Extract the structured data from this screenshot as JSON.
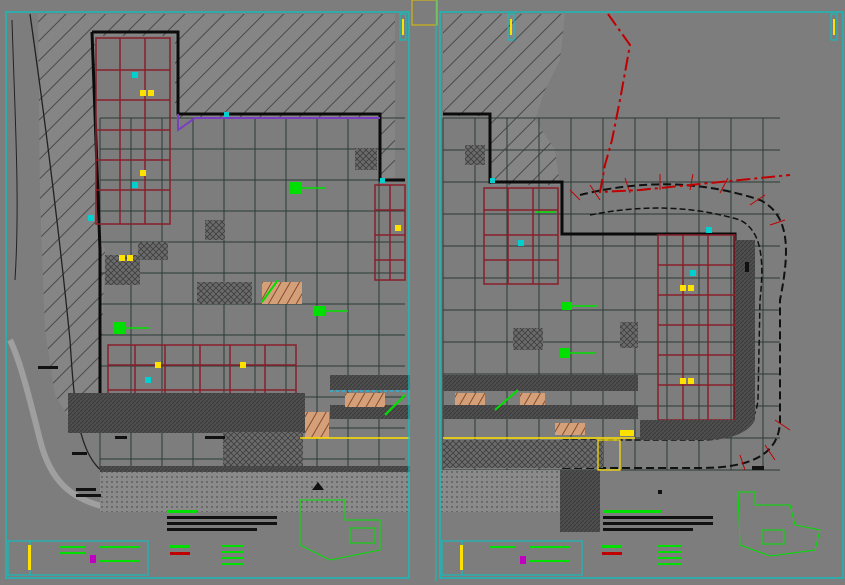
{
  "drawing": {
    "sheets": [
      {
        "name": "sheet-left"
      },
      {
        "name": "sheet-right"
      }
    ],
    "legend_left": {
      "title": "",
      "lines": [
        "",
        "",
        ""
      ]
    },
    "legend_right": {
      "title": "",
      "lines": [
        "",
        "",
        ""
      ]
    },
    "tags": {
      "compass": "",
      "north_label": ""
    },
    "colors": {
      "background": "#7d7d7d",
      "frame": "#00c8c8",
      "grid": "#2b3a36",
      "building_outline": "#0b0b0b",
      "structure": "#8a1f2a",
      "fixture": "#ffe100",
      "annotation": "#00e000",
      "path": "#c00000",
      "hatch": "#5a5a5a",
      "paving": "#e0b090"
    }
  }
}
